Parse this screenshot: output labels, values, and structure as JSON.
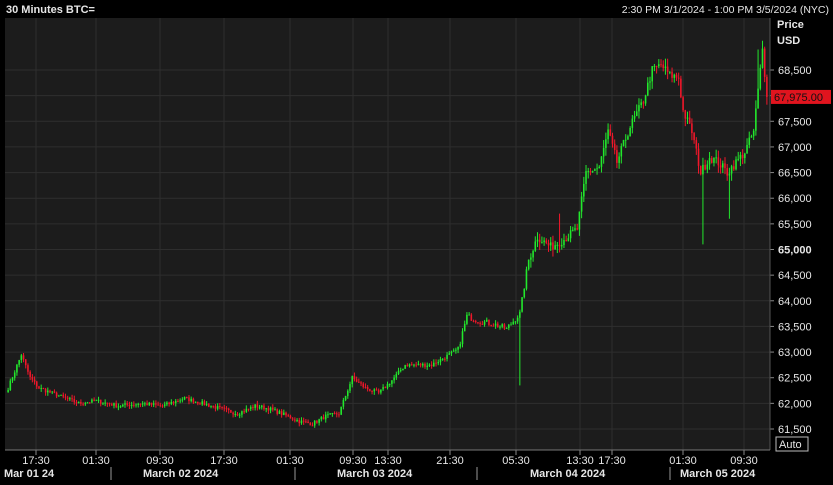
{
  "header": {
    "title": "30 Minutes BTC=",
    "range": "2:30 PM 3/1/2024 - 1:00 PM 3/5/2024 (NYC)"
  },
  "axis": {
    "price_label": "Price",
    "currency_label": "USD",
    "auto_label": "Auto"
  },
  "colors": {
    "background": "#000000",
    "plot_background": "#1c1c1c",
    "grid": "#2e2e2e",
    "up": "#22e82c",
    "down": "#f0172a",
    "last_price_badge": "#e0141e",
    "text": "#e6e6e6"
  },
  "chart_data": {
    "type": "candlestick",
    "title": "30 Minutes BTC=",
    "time_range": "2:30 PM 3/1/2024 - 1:00 PM 3/5/2024 (NYC)",
    "interval_minutes": 30,
    "ylim": [
      61500,
      68800
    ],
    "yticks": [
      61500,
      62000,
      62500,
      63000,
      63500,
      64000,
      64500,
      65000,
      65500,
      66000,
      66500,
      67000,
      67500,
      68000,
      68500
    ],
    "ytick_labels": [
      "61,500",
      "62,000",
      "62,500",
      "63,000",
      "63,500",
      "64,000",
      "64,500",
      "65,000",
      "65,500",
      "66,000",
      "66,500",
      "67,000",
      "67,500",
      "68,000",
      "68,500"
    ],
    "ytick_bold": [
      "65,000"
    ],
    "last_price": 67975,
    "last_price_label": "67,975.00",
    "xticks": [
      "17:30",
      "01:30",
      "09:30",
      "17:30",
      "01:30",
      "09:30",
      "13:30",
      "21:30",
      "05:30",
      "13:30",
      "17:30",
      "01:30",
      "09:30"
    ],
    "xdates": [
      "Mar 01 24",
      "March 02 2024",
      "March 03 2024",
      "March 04 2024",
      "March 05 2024"
    ],
    "legend": "none",
    "grid": true,
    "close_path": [
      [
        0,
        62300
      ],
      [
        6,
        62950
      ],
      [
        10,
        62500
      ],
      [
        14,
        62300
      ],
      [
        20,
        62200
      ],
      [
        26,
        62100
      ],
      [
        32,
        62000
      ],
      [
        40,
        62050
      ],
      [
        50,
        61950
      ],
      [
        60,
        62000
      ],
      [
        70,
        61950
      ],
      [
        80,
        62100
      ],
      [
        88,
        62000
      ],
      [
        96,
        61900
      ],
      [
        104,
        61800
      ],
      [
        112,
        61950
      ],
      [
        118,
        61900
      ],
      [
        124,
        61800
      ],
      [
        132,
        61650
      ],
      [
        138,
        61600
      ],
      [
        144,
        61750
      ],
      [
        150,
        61800
      ],
      [
        156,
        62500
      ],
      [
        162,
        62300
      ],
      [
        168,
        62200
      ],
      [
        174,
        62450
      ],
      [
        180,
        62750
      ],
      [
        192,
        62750
      ],
      [
        200,
        62950
      ],
      [
        204,
        63050
      ],
      [
        208,
        63700
      ],
      [
        214,
        63600
      ],
      [
        220,
        63550
      ],
      [
        226,
        63450
      ],
      [
        232,
        63750
      ],
      [
        236,
        64800
      ],
      [
        240,
        65250
      ],
      [
        246,
        65050
      ],
      [
        252,
        65200
      ],
      [
        258,
        65400
      ],
      [
        262,
        66500
      ],
      [
        268,
        66600
      ],
      [
        272,
        67300
      ],
      [
        276,
        66700
      ],
      [
        282,
        67400
      ],
      [
        288,
        67900
      ],
      [
        292,
        68500
      ],
      [
        296,
        68600
      ],
      [
        300,
        68400
      ],
      [
        304,
        68350
      ],
      [
        306,
        67700
      ],
      [
        310,
        67300
      ],
      [
        314,
        66500
      ],
      [
        318,
        66800
      ],
      [
        322,
        66700
      ],
      [
        326,
        66500
      ],
      [
        330,
        66700
      ],
      [
        334,
        66900
      ],
      [
        338,
        67300
      ],
      [
        342,
        68900
      ],
      [
        344,
        67975
      ]
    ]
  }
}
